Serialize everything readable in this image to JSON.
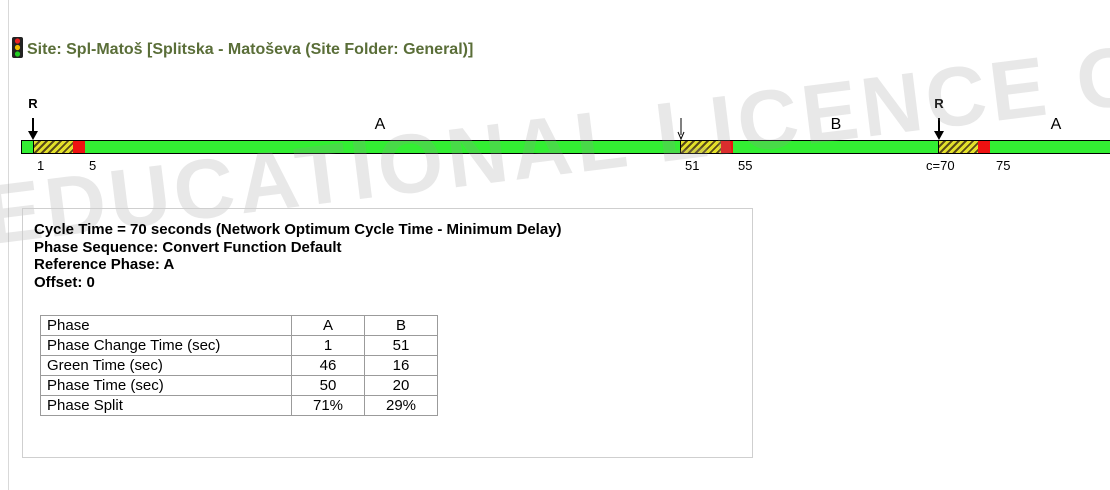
{
  "site": {
    "title": "Site: Spl-Matoš [Splitska - Matoševa  (Site Folder: General)]",
    "icon": "traffic-light-icon"
  },
  "timeline": {
    "reference_marker": "R",
    "phase_labels": [
      "A",
      "B",
      "A"
    ],
    "ticks": [
      "1",
      "5",
      "51",
      "55",
      "c=70",
      "75"
    ],
    "colors": {
      "green": "#33ee33",
      "amber_hatch": "#e3e12a",
      "red": "#ee1111"
    }
  },
  "info": {
    "cycle_time": "Cycle Time = 70 seconds  (Network Optimum Cycle Time - Minimum Delay)",
    "phase_sequence": "Phase Sequence: Convert Function Default",
    "reference_phase": "Reference Phase: A",
    "offset": "Offset: 0"
  },
  "table": {
    "rows": [
      {
        "label": "Phase",
        "a": "A",
        "b": "B"
      },
      {
        "label": "Phase Change Time (sec)",
        "a": "1",
        "b": "51"
      },
      {
        "label": "Green Time (sec)",
        "a": "46",
        "b": "16"
      },
      {
        "label": "Phase Time (sec)",
        "a": "50",
        "b": "20"
      },
      {
        "label": "Phase Split",
        "a": "71%",
        "b": "29%"
      }
    ]
  },
  "watermark": "EDUCATIONAL LICENCE ONLY"
}
